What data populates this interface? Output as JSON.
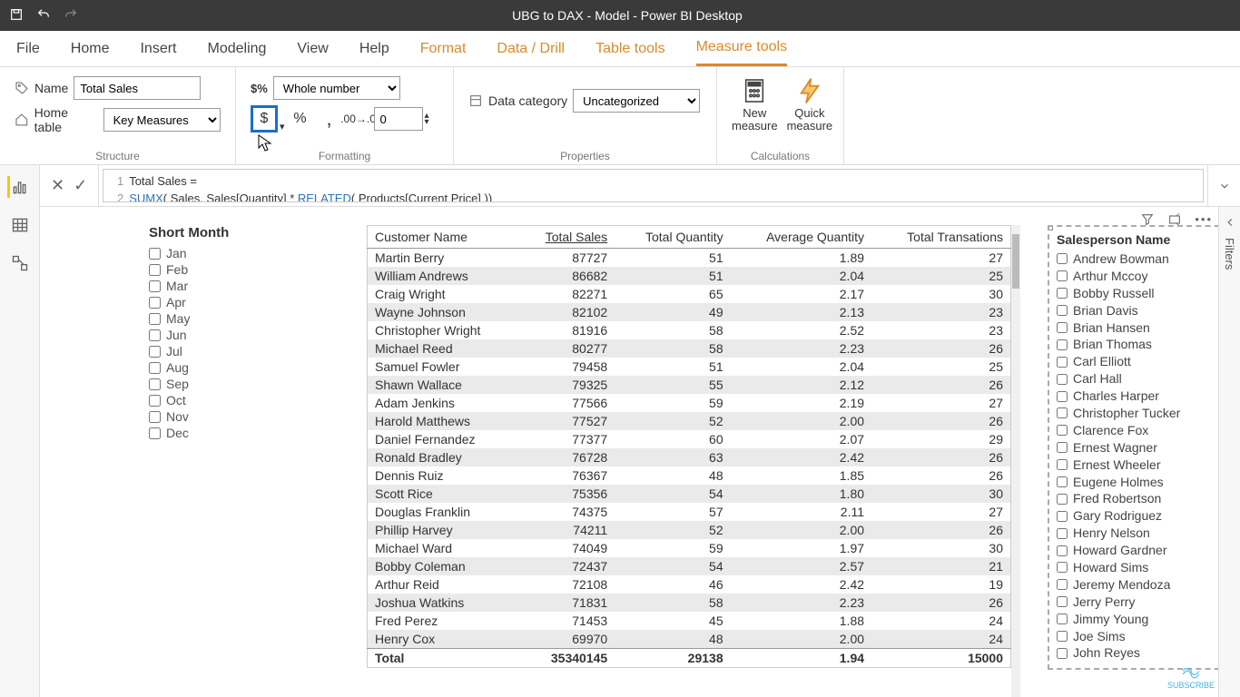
{
  "app": {
    "title": "UBG to DAX - Model - Power BI Desktop"
  },
  "ribbon_tabs": [
    "File",
    "Home",
    "Insert",
    "Modeling",
    "View",
    "Help",
    "Format",
    "Data / Drill",
    "Table tools",
    "Measure tools"
  ],
  "structure": {
    "name_label": "Name",
    "name_value": "Total Sales",
    "home_table_label": "Home table",
    "home_table_value": "Key Measures",
    "group_label": "Structure"
  },
  "formatting": {
    "format_value": "Whole number",
    "decimal_value": "0",
    "group_label": "Formatting"
  },
  "properties": {
    "data_category_label": "Data category",
    "data_category_value": "Uncategorized",
    "group_label": "Properties"
  },
  "calculations": {
    "new_measure": "New measure",
    "quick_measure": "Quick measure",
    "group_label": "Calculations"
  },
  "formula": {
    "line1_prefix": "Total Sales =",
    "line2_kw1": "SUMX",
    "line2_mid": "( Sales, Sales[Quantity] * ",
    "line2_kw2": "RELATED",
    "line2_end": "( Products[Current Price] ))"
  },
  "month_slicer": {
    "title": "Short Month",
    "items": [
      "Jan",
      "Feb",
      "Mar",
      "Apr",
      "May",
      "Jun",
      "Jul",
      "Aug",
      "Sep",
      "Oct",
      "Nov",
      "Dec"
    ]
  },
  "table": {
    "columns": [
      "Customer Name",
      "Total Sales",
      "Total Quantity",
      "Average Quantity",
      "Total Transations"
    ],
    "rows": [
      [
        "Martin Berry",
        "87727",
        "51",
        "1.89",
        "27"
      ],
      [
        "William Andrews",
        "86682",
        "51",
        "2.04",
        "25"
      ],
      [
        "Craig Wright",
        "82271",
        "65",
        "2.17",
        "30"
      ],
      [
        "Wayne Johnson",
        "82102",
        "49",
        "2.13",
        "23"
      ],
      [
        "Christopher Wright",
        "81916",
        "58",
        "2.52",
        "23"
      ],
      [
        "Michael Reed",
        "80277",
        "58",
        "2.23",
        "26"
      ],
      [
        "Samuel Fowler",
        "79458",
        "51",
        "2.04",
        "25"
      ],
      [
        "Shawn Wallace",
        "79325",
        "55",
        "2.12",
        "26"
      ],
      [
        "Adam Jenkins",
        "77566",
        "59",
        "2.19",
        "27"
      ],
      [
        "Harold Matthews",
        "77527",
        "52",
        "2.00",
        "26"
      ],
      [
        "Daniel Fernandez",
        "77377",
        "60",
        "2.07",
        "29"
      ],
      [
        "Ronald Bradley",
        "76728",
        "63",
        "2.42",
        "26"
      ],
      [
        "Dennis Ruiz",
        "76367",
        "48",
        "1.85",
        "26"
      ],
      [
        "Scott Rice",
        "75356",
        "54",
        "1.80",
        "30"
      ],
      [
        "Douglas Franklin",
        "74375",
        "57",
        "2.11",
        "27"
      ],
      [
        "Phillip Harvey",
        "74211",
        "52",
        "2.00",
        "26"
      ],
      [
        "Michael Ward",
        "74049",
        "59",
        "1.97",
        "30"
      ],
      [
        "Bobby Coleman",
        "72437",
        "54",
        "2.57",
        "21"
      ],
      [
        "Arthur Reid",
        "72108",
        "46",
        "2.42",
        "19"
      ],
      [
        "Joshua Watkins",
        "71831",
        "58",
        "2.23",
        "26"
      ],
      [
        "Fred Perez",
        "71453",
        "45",
        "1.88",
        "24"
      ],
      [
        "Henry Cox",
        "69970",
        "48",
        "2.00",
        "24"
      ]
    ],
    "total_label": "Total",
    "totals": [
      "35340145",
      "29138",
      "1.94",
      "15000"
    ]
  },
  "sales_slicer": {
    "title": "Salesperson Name",
    "items": [
      "Andrew Bowman",
      "Arthur Mccoy",
      "Bobby Russell",
      "Brian Davis",
      "Brian Hansen",
      "Brian Thomas",
      "Carl Elliott",
      "Carl Hall",
      "Charles Harper",
      "Christopher Tucker",
      "Clarence Fox",
      "Ernest Wagner",
      "Ernest Wheeler",
      "Eugene Holmes",
      "Fred Robertson",
      "Gary Rodriguez",
      "Henry Nelson",
      "Howard Gardner",
      "Howard Sims",
      "Jeremy Mendoza",
      "Jerry Perry",
      "Jimmy Young",
      "Joe Sims",
      "John Reyes"
    ]
  },
  "filters_label": "Filters",
  "subscribe_label": "SUBSCRIBE"
}
